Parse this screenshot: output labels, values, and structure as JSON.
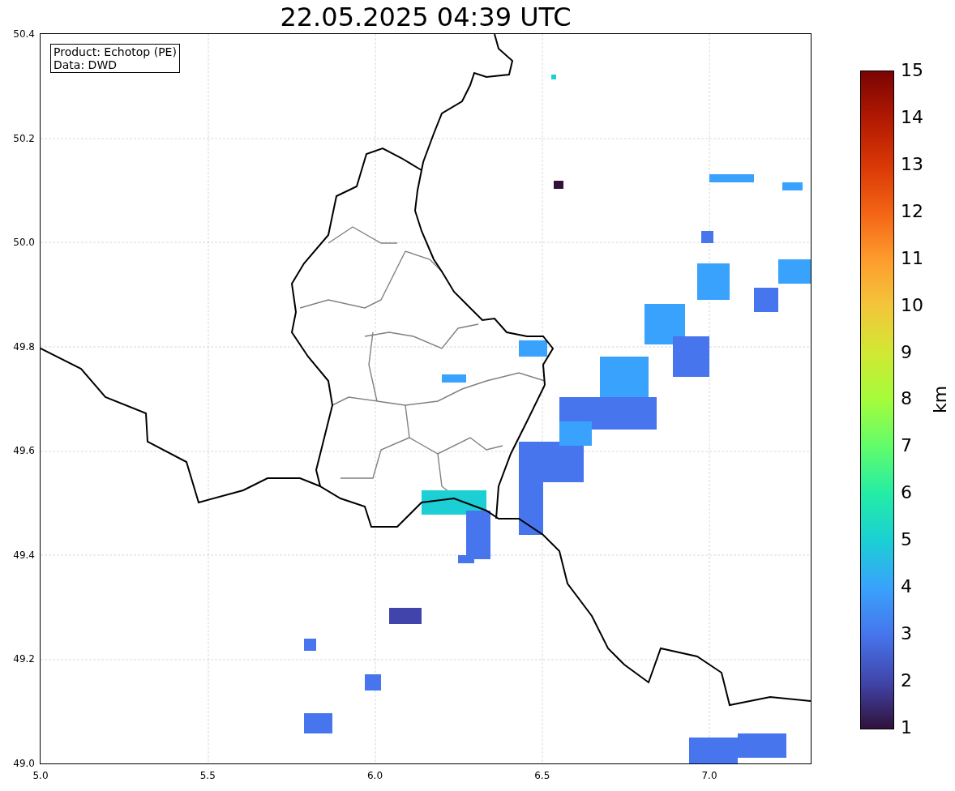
{
  "title": "22.05.2025 04:39 UTC",
  "info_box": [
    "Product: Echotop (PE)",
    "Data: DWD"
  ],
  "y_ticks": [
    "50.4",
    "50.2",
    "50.0",
    "49.8",
    "49.6",
    "49.4",
    "49.2",
    "49.0"
  ],
  "x_ticks": [
    "5.0",
    "5.5",
    "6.0",
    "6.5",
    "7.0"
  ],
  "colorbar": {
    "ticks": [
      "15",
      "14",
      "13",
      "12",
      "11",
      "10",
      "9",
      "8",
      "7",
      "6",
      "5",
      "4",
      "3",
      "2",
      "1"
    ],
    "label": "km"
  }
}
